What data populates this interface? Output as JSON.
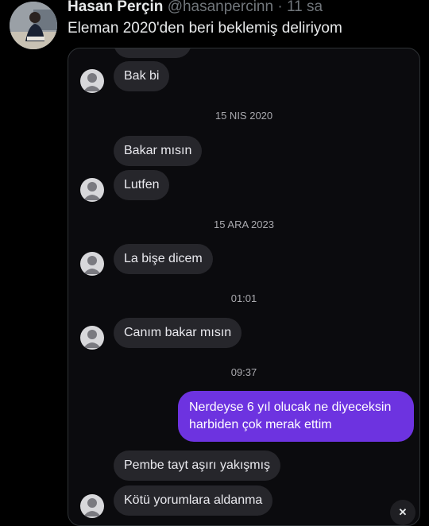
{
  "tweet": {
    "author_name": "Hasan Perçin",
    "handle": "@hasanpercinn",
    "separator": "·",
    "time": "11 sa",
    "text": "Eleman 2020'den beri beklemiş deliriyom"
  },
  "chat": {
    "messages": [
      {
        "text": "Bak bi"
      },
      {
        "timestamp": "15 NIS 2020"
      },
      {
        "text": "Bakar mısın"
      },
      {
        "text": "Lutfen"
      },
      {
        "timestamp": "15 ARA 2023"
      },
      {
        "text": "La bişe dicem"
      },
      {
        "timestamp": "01:01"
      },
      {
        "text": "Canım bakar mısın"
      },
      {
        "timestamp": "09:37"
      },
      {
        "text": "Nerdeyse 6 yıl olucak ne diyeceksin harbiden çok merak ettim"
      },
      {
        "text": "Pembe tayt aşırı yakışmış"
      },
      {
        "text": "Kötü yorumlara aldanma"
      }
    ]
  },
  "colors": {
    "sent_bubble": "#6d33e0",
    "received_bubble": "#26262b",
    "background": "#000000"
  },
  "icons": [
    "user-avatar-icon",
    "default-avatar-icon",
    "close-icon"
  ]
}
